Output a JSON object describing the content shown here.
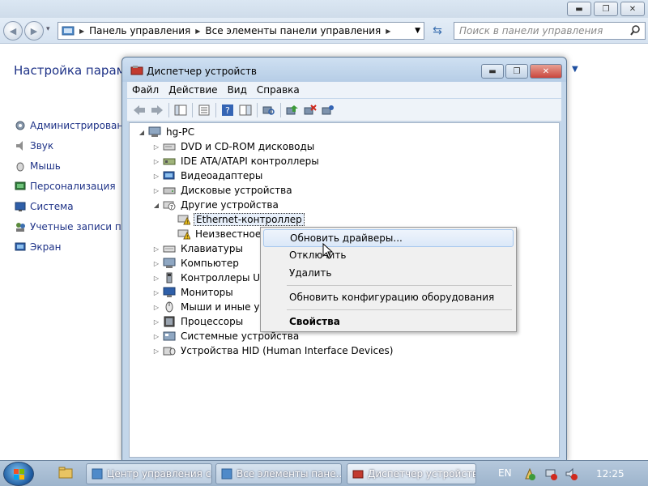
{
  "control_panel": {
    "breadcrumb": [
      "Панель управления",
      "Все элементы панели управления"
    ],
    "search_placeholder": "Поиск в панели управления",
    "heading": "Настройка параме",
    "links": [
      "Администрирование",
      "Звук",
      "Мышь",
      "Персонализация",
      "Система",
      "Учетные записи пол",
      "Экран"
    ]
  },
  "device_manager": {
    "title": "Диспетчер устройств",
    "menu": [
      "Файл",
      "Действие",
      "Вид",
      "Справка"
    ],
    "tree": [
      {
        "label": "hg-PC",
        "level": 0,
        "expander": "open",
        "icon": "computer-icon"
      },
      {
        "label": "DVD и CD-ROM дисководы",
        "level": 1,
        "expander": "closed",
        "icon": "dvd-drive-icon"
      },
      {
        "label": "IDE ATA/ATAPI контроллеры",
        "level": 1,
        "expander": "closed",
        "icon": "ide-controller-icon"
      },
      {
        "label": "Видеоадаптеры",
        "level": 1,
        "expander": "closed",
        "icon": "display-adapter-icon"
      },
      {
        "label": "Дисковые устройства",
        "level": 1,
        "expander": "closed",
        "icon": "disk-drive-icon"
      },
      {
        "label": "Другие устройства",
        "level": 1,
        "expander": "open",
        "icon": "unknown-device-icon"
      },
      {
        "label": "Ethernet-контроллер",
        "level": 2,
        "expander": "none",
        "icon": "warning-device-icon",
        "selected": true
      },
      {
        "label": "Неизвестное ус",
        "level": 2,
        "expander": "none",
        "icon": "warning-device-icon"
      },
      {
        "label": "Клавиатуры",
        "level": 1,
        "expander": "closed",
        "icon": "keyboard-icon"
      },
      {
        "label": "Компьютер",
        "level": 1,
        "expander": "closed",
        "icon": "computer-icon"
      },
      {
        "label": "Контроллеры USB",
        "level": 1,
        "expander": "closed",
        "icon": "usb-icon"
      },
      {
        "label": "Мониторы",
        "level": 1,
        "expander": "closed",
        "icon": "monitor-icon"
      },
      {
        "label": "Мыши и иные ука",
        "level": 1,
        "expander": "closed",
        "icon": "mouse-icon"
      },
      {
        "label": "Процессоры",
        "level": 1,
        "expander": "closed",
        "icon": "processor-icon"
      },
      {
        "label": "Системные устройства",
        "level": 1,
        "expander": "closed",
        "icon": "system-device-icon"
      },
      {
        "label": "Устройства HID (Human Interface Devices)",
        "level": 1,
        "expander": "closed",
        "icon": "hid-icon"
      }
    ]
  },
  "context_menu": {
    "update_drivers": "Обновить драйверы...",
    "disable": "Отключить",
    "uninstall": "Удалить",
    "scan_hardware": "Обновить конфигурацию оборудования",
    "properties": "Свойства"
  },
  "taskbar": {
    "tasks": [
      "Центр управления с...",
      "Все элементы пане...",
      "Диспетчер устройств"
    ],
    "language": "EN",
    "clock": "12:25"
  },
  "colors": {
    "link": "#1e3287",
    "window_frame": "#c3d6ea",
    "close_button": "#c9463d",
    "taskbar": "#9db4cc"
  }
}
